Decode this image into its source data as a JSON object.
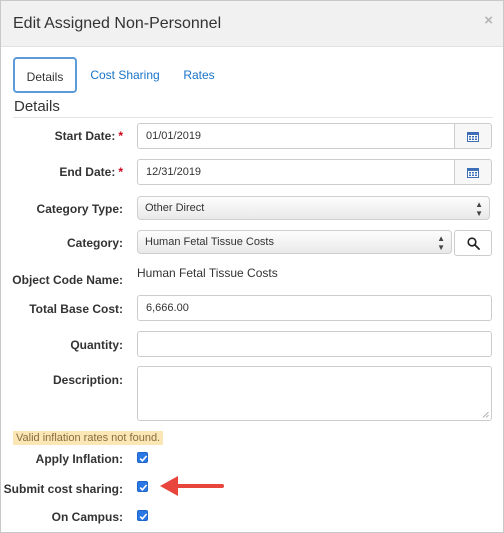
{
  "dialog": {
    "title": "Edit Assigned Non-Personnel",
    "close_glyph": "×"
  },
  "tabs": [
    "Details",
    "Cost Sharing",
    "Rates"
  ],
  "section_title": "Details",
  "form": {
    "start_date": {
      "label": "Start Date:",
      "value": "01/01/2019",
      "required_mark": "*"
    },
    "end_date": {
      "label": "End Date:",
      "value": "12/31/2019",
      "required_mark": "*"
    },
    "category_type": {
      "label": "Category Type:",
      "value": "Other Direct"
    },
    "category": {
      "label": "Category:",
      "value": "Human Fetal Tissue Costs"
    },
    "object_code_name": {
      "label": "Object Code Name:",
      "value": "Human Fetal Tissue Costs"
    },
    "total_base_cost": {
      "label": "Total Base Cost:",
      "value": "6,666.00"
    },
    "quantity": {
      "label": "Quantity:",
      "value": ""
    },
    "description": {
      "label": "Description:",
      "value": ""
    }
  },
  "warning": "Valid inflation rates not found.",
  "checkboxes": {
    "apply_inflation": {
      "label": "Apply Inflation:",
      "checked": true
    },
    "submit_cost_sharing": {
      "label": "Submit cost sharing:",
      "checked": true
    },
    "on_campus": {
      "label": "On Campus:",
      "checked": true
    }
  },
  "colors": {
    "accent": "#2b78e4",
    "tab_link": "#1a73c7",
    "required": "#d0021b",
    "warning_bg": "#fbe7b6",
    "arrow": "#e8453c"
  },
  "icons": [
    "close-icon",
    "calendar-icon",
    "search-icon",
    "select-arrows-icon",
    "resize-grip-icon",
    "check-icon",
    "arrow-pointer-icon"
  ]
}
